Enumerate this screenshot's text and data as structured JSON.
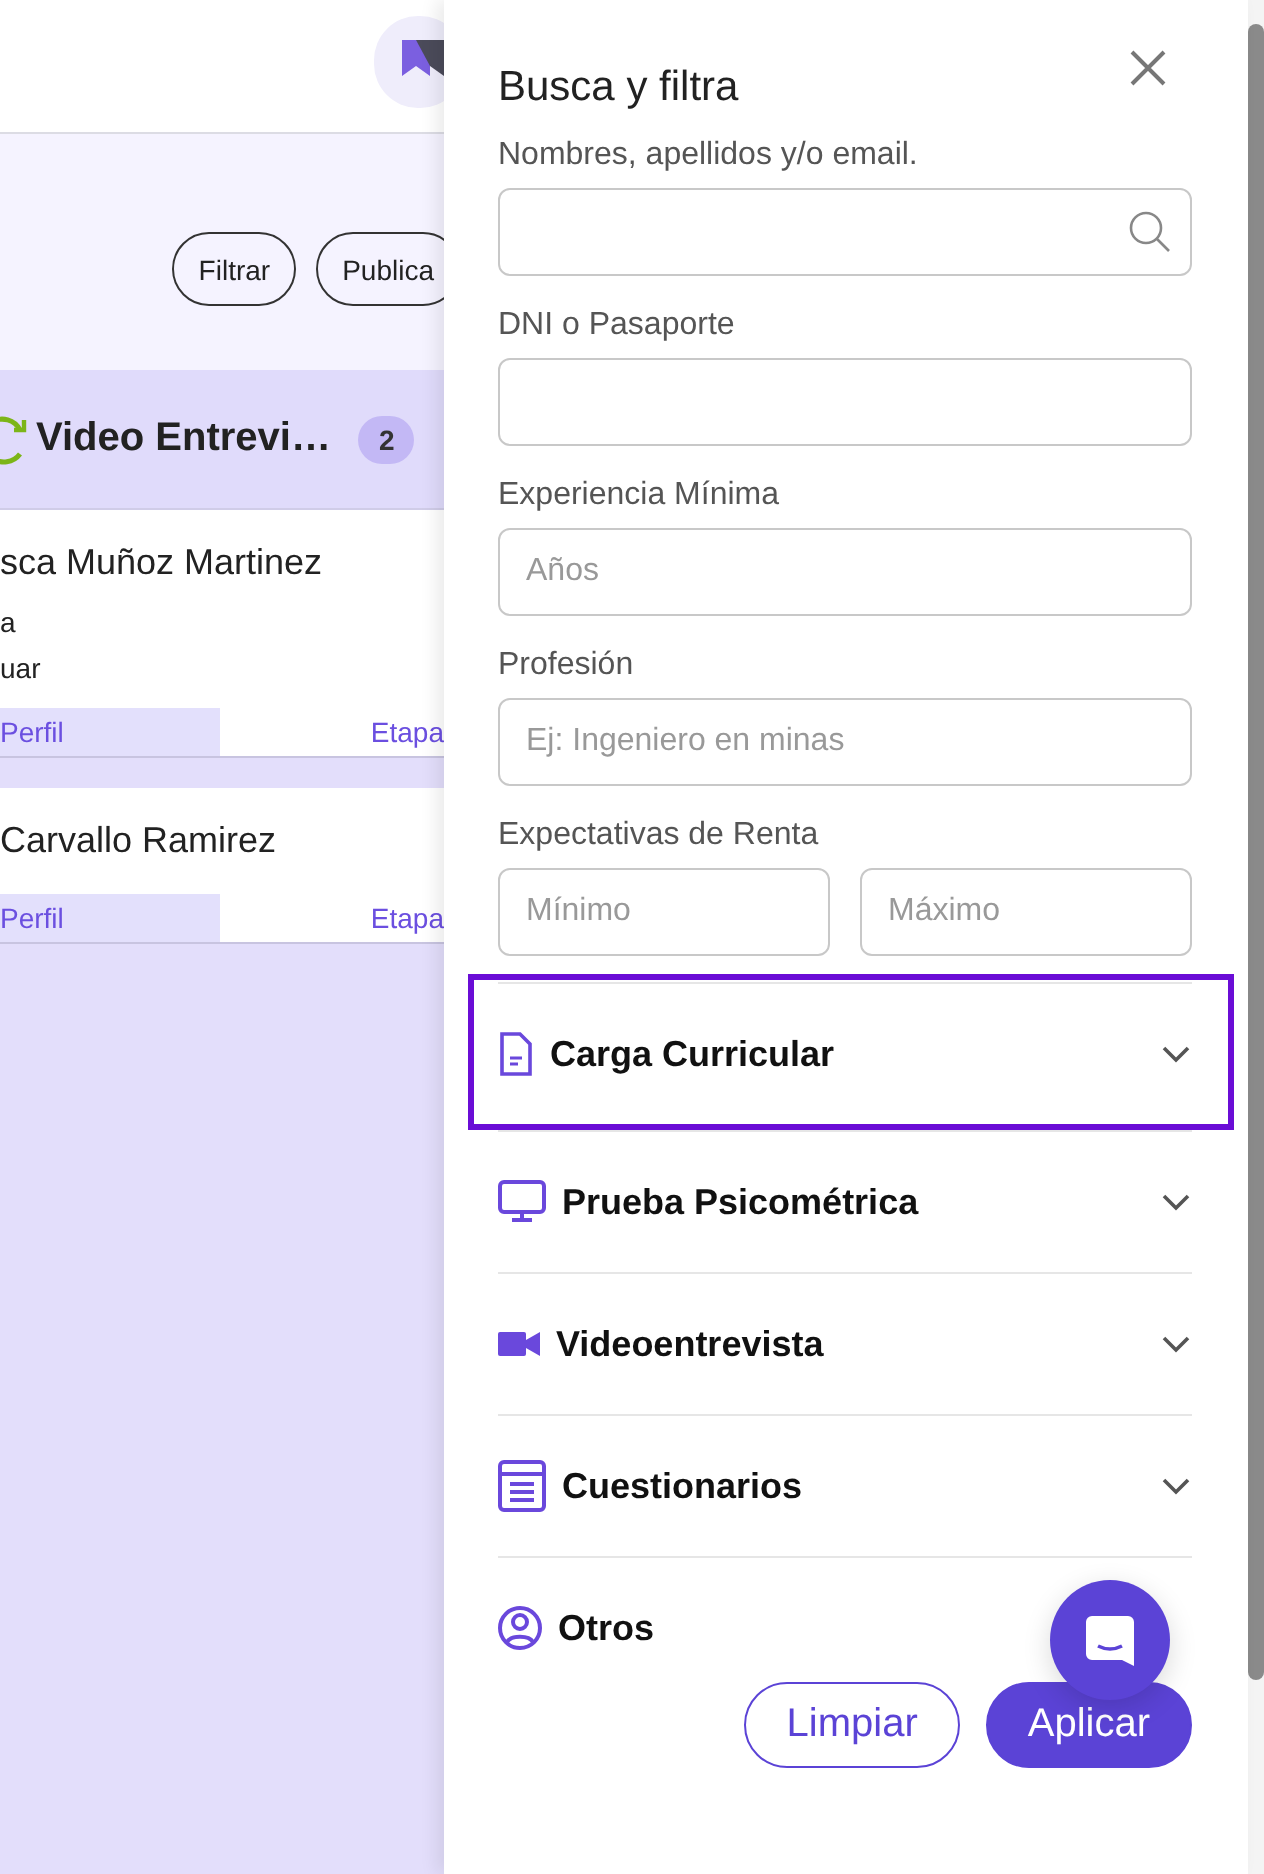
{
  "background": {
    "toolbar_buttons": [
      "Filtrar",
      "Publica"
    ],
    "column": {
      "title": "Video Entrevi…",
      "count": "2",
      "cards": [
        {
          "name": "sca Muñoz Martinez",
          "lines": [
            "a",
            "uar"
          ],
          "actions": [
            "Perfil",
            "Etapa"
          ]
        },
        {
          "name": "Carvallo Ramirez",
          "actions": [
            "Perfil",
            "Etapa"
          ]
        }
      ]
    }
  },
  "panel": {
    "title": "Busca y filtra",
    "fields": [
      {
        "label": "Nombres, apellidos y/o email.",
        "inputs": [
          {
            "kind": "search"
          }
        ]
      },
      {
        "label": "DNI o Pasaporte",
        "inputs": [
          {
            "kind": "text"
          }
        ]
      },
      {
        "label": "Experiencia Mínima",
        "inputs": [
          {
            "kind": "text",
            "placeholder": "Años"
          }
        ]
      },
      {
        "label": "Profesión",
        "inputs": [
          {
            "kind": "text",
            "placeholder": "Ej: Ingeniero en minas"
          }
        ]
      },
      {
        "label": "Expectativas de Renta",
        "inputs": [
          {
            "kind": "text",
            "placeholder": "Mínimo"
          },
          {
            "kind": "text",
            "placeholder": "Máximo"
          }
        ]
      }
    ],
    "sections": [
      {
        "title": "Carga Curricular",
        "kind": "document",
        "highlighted": true
      },
      {
        "title": "Prueba Psicométrica",
        "kind": "monitor",
        "highlighted": false
      },
      {
        "title": "Videoentrevista",
        "kind": "video",
        "highlighted": false
      },
      {
        "title": "Cuestionarios",
        "kind": "form",
        "highlighted": false
      },
      {
        "title": "Otros",
        "kind": "user",
        "highlighted": false
      }
    ],
    "buttons": [
      {
        "label": "Limpiar",
        "kind": "outline"
      },
      {
        "label": "Aplicar",
        "kind": "primary"
      }
    ]
  }
}
